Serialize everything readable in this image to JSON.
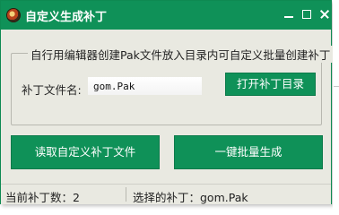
{
  "window": {
    "title": "自定义生成补丁",
    "controls": {
      "minimize": "minimize",
      "maximize": "maximize",
      "close": "close"
    }
  },
  "group": {
    "title": "自行用编辑器创建Pak文件放入目录内可自定义批量创建补丁",
    "filename_label": "补丁文件名:",
    "filename_value": "gom.Pak",
    "open_dir_button": "打开补丁目录"
  },
  "actions": {
    "read_button": "读取自定义补丁文件",
    "batch_button": "一键批量生成"
  },
  "status": {
    "count_text": "当前补丁数：2",
    "selected_text": "选择的补丁：gom.Pak"
  },
  "colors": {
    "accent": "#0f9158",
    "background": "#e9e9e1"
  },
  "icons": {
    "app": "game-logo-icon"
  }
}
